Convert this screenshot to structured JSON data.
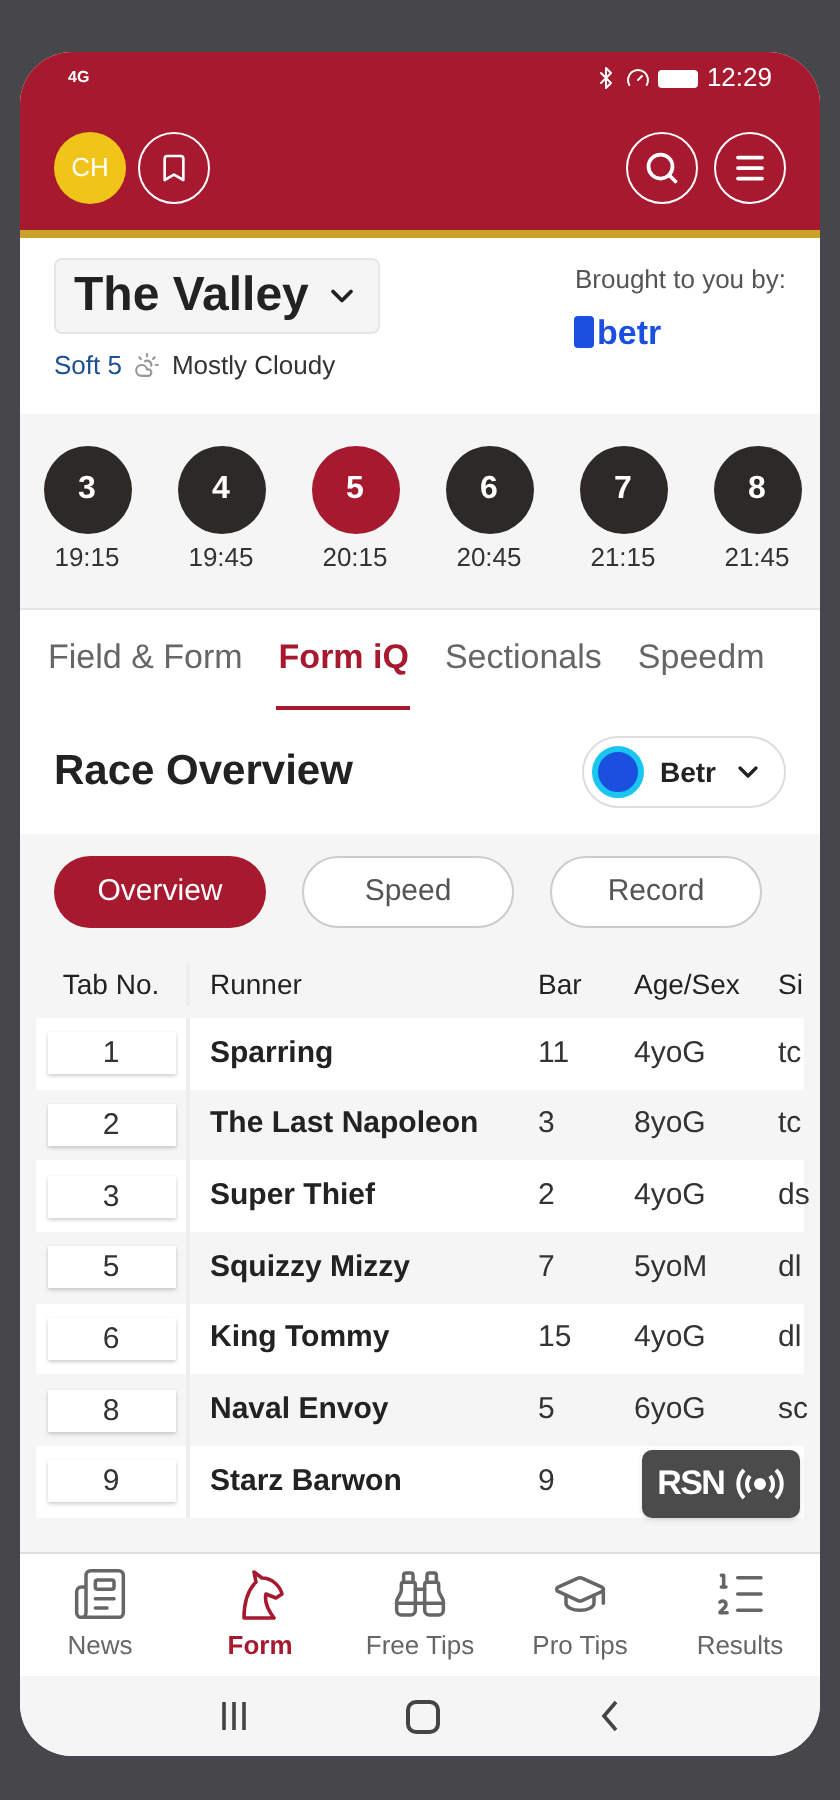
{
  "status_bar": {
    "network": "4G",
    "time": "12:29"
  },
  "header": {
    "avatar": "CH"
  },
  "venue": {
    "name": "The Valley",
    "track": "Soft 5",
    "weather": "Mostly Cloudy",
    "sponsor_label": "Brought to you by:",
    "sponsor": "betr"
  },
  "races": [
    {
      "number": "3",
      "time": "19:15",
      "selected": false
    },
    {
      "number": "4",
      "time": "19:45",
      "selected": false
    },
    {
      "number": "5",
      "time": "20:15",
      "selected": true
    },
    {
      "number": "6",
      "time": "20:45",
      "selected": false
    },
    {
      "number": "7",
      "time": "21:15",
      "selected": false
    },
    {
      "number": "8",
      "time": "21:45",
      "selected": false
    }
  ],
  "tabs": [
    {
      "label": "Field & Form",
      "selected": false
    },
    {
      "label": "Form iQ",
      "selected": true
    },
    {
      "label": "Sectionals",
      "selected": false
    },
    {
      "label": "Speedm",
      "selected": false
    }
  ],
  "section": {
    "title": "Race Overview",
    "bookmaker": "Betr"
  },
  "chips": [
    {
      "label": "Overview",
      "selected": true
    },
    {
      "label": "Speed",
      "selected": false
    },
    {
      "label": "Record",
      "selected": false
    }
  ],
  "table": {
    "columns": [
      "Tab No.",
      "Runner",
      "Bar",
      "Age/Sex",
      "Si"
    ],
    "rows": [
      [
        "1",
        "Sparring",
        "11",
        "4yoG",
        "tc"
      ],
      [
        "2",
        "The Last Napoleon",
        "3",
        "8yoG",
        "tc"
      ],
      [
        "3",
        "Super Thief",
        "2",
        "4yoG",
        "ds"
      ],
      [
        "5",
        "Squizzy Mizzy",
        "7",
        "5yoM",
        "dl"
      ],
      [
        "6",
        "King Tommy",
        "15",
        "4yoG",
        "dl"
      ],
      [
        "8",
        "Naval Envoy",
        "5",
        "6yoG",
        "sc"
      ],
      [
        "9",
        "Starz Barwon",
        "9"
      ]
    ]
  },
  "live_badge": "RSN",
  "bottom_nav": [
    {
      "label": "News",
      "selected": false,
      "kind": "news"
    },
    {
      "label": "Form",
      "selected": true,
      "kind": "horse"
    },
    {
      "label": "Free Tips",
      "selected": false,
      "kind": "binoculars"
    },
    {
      "label": "Pro Tips",
      "selected": false,
      "kind": "cap"
    },
    {
      "label": "Results",
      "selected": false,
      "kind": "list"
    }
  ]
}
